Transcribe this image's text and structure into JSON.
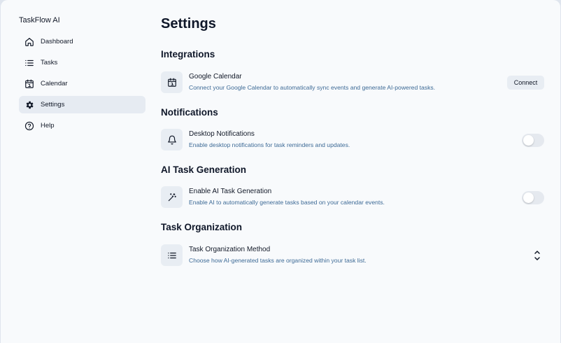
{
  "app": {
    "title": "TaskFlow AI"
  },
  "sidebar": {
    "items": [
      {
        "label": "Dashboard",
        "icon": "home-icon",
        "active": false
      },
      {
        "label": "Tasks",
        "icon": "list-icon",
        "active": false
      },
      {
        "label": "Calendar",
        "icon": "calendar-icon",
        "active": false
      },
      {
        "label": "Settings",
        "icon": "gear-icon",
        "active": true
      },
      {
        "label": "Help",
        "icon": "help-circle-icon",
        "active": false
      }
    ]
  },
  "page": {
    "title": "Settings"
  },
  "sections": {
    "integrations": {
      "title": "Integrations",
      "google_calendar": {
        "icon": "calendar-icon",
        "title": "Google Calendar",
        "description": "Connect your Google Calendar to automatically sync events and generate AI-powered tasks.",
        "button_label": "Connect"
      }
    },
    "notifications": {
      "title": "Notifications",
      "desktop": {
        "icon": "bell-icon",
        "title": "Desktop Notifications",
        "description": "Enable desktop notifications for task reminders and updates.",
        "enabled": false
      }
    },
    "ai_generation": {
      "title": "AI Task Generation",
      "enable": {
        "icon": "magic-wand-icon",
        "title": "Enable AI Task Generation",
        "description": "Enable AI to automatically generate tasks based on your calendar events.",
        "enabled": false
      }
    },
    "organization": {
      "title": "Task Organization",
      "method": {
        "icon": "list-icon",
        "title": "Task Organization Method",
        "description": "Choose how AI-generated tasks are organized within your task list.",
        "control_icon": "chevron-up-down-icon"
      }
    }
  },
  "colors": {
    "background": "#f8fafc",
    "active_nav": "#e6ebf2",
    "description_text": "#3d6a96",
    "tile_bg": "#e8edf3"
  }
}
